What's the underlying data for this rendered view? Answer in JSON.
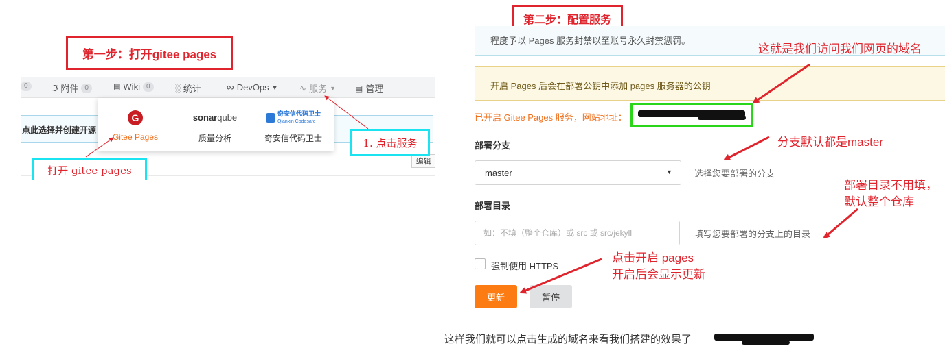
{
  "step1": {
    "label": "第一步：打开gitee pages"
  },
  "step2": {
    "label": "第二步：配置服务"
  },
  "gitee_nav": {
    "count_left": "0",
    "attachments": {
      "label": "附件",
      "count": "0"
    },
    "wiki": {
      "label": "Wiki",
      "count": "0"
    },
    "stats": {
      "label": "统计"
    },
    "devops": {
      "label": "DevOps"
    },
    "services": {
      "label": "服务"
    },
    "manage": {
      "label": "管理"
    }
  },
  "info_strip": {
    "text": "点此选择并创建开源"
  },
  "edit_button": {
    "label": "编辑"
  },
  "services_dropdown": {
    "gitee_pages": {
      "logo_letter": "G",
      "label": "Gitee Pages"
    },
    "sonarqube": {
      "logo_bold": "sonar",
      "logo_light": "qube",
      "label": "质量分析"
    },
    "qianxin": {
      "logo_title": "奇安信代码卫士",
      "logo_subtitle": "Qianxin Codesafe",
      "label": "奇安信代码卫士"
    }
  },
  "annotations_left": {
    "open_pages": "打开 gitee pages",
    "click_service": "1. 点击服务"
  },
  "pages_settings": {
    "notice_blue": "程度予以 Pages 服务封禁以至账号永久封禁惩罚。",
    "notice_yellow": "开启 Pages 后会在部署公钥中添加 pages 服务器的公钥",
    "status_text": "已开启 Gitee Pages 服务，网站地址：",
    "branch_label": "部署分支",
    "branch_value": "master",
    "branch_hint": "选择您要部署的分支",
    "dir_label": "部署目录",
    "dir_placeholder": "如：不填（整个仓库）或 src 或 src/jekyll",
    "dir_hint": "填写您要部署的分支上的目录",
    "https_label": "强制使用 HTTPS",
    "update_button": "更新",
    "pause_button": "暂停"
  },
  "annotations_right": {
    "domain_note": "这就是我们访问我们网页的域名",
    "branch_note": "分支默认都是master",
    "dir_note_line1": "部署目录不用填，",
    "dir_note_line2": "默认整个仓库",
    "click_note_line1": "点击开启 pages",
    "click_note_line2": "开启后会显示更新"
  },
  "bottom_caption": "这样我们就可以点击生成的域名来看我们搭建的效果了",
  "colors": {
    "annotation_red": "#e0242d",
    "cyan_box": "#1be3f0",
    "green_box": "#2bd61a",
    "orange_button": "#fc7c13",
    "status_orange": "#f0701d",
    "gitee_red": "#c71d23"
  }
}
